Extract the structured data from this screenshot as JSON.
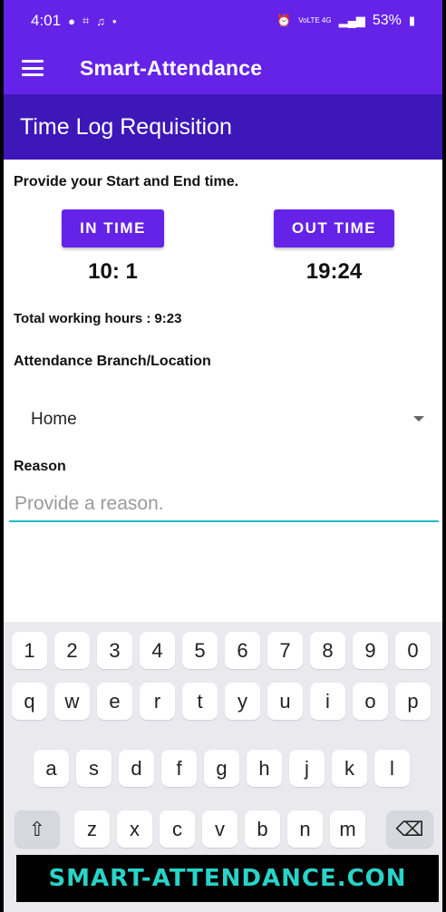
{
  "status_bar": {
    "time": "4:01",
    "network_label": "VoLTE 4G",
    "battery_percent": "53%"
  },
  "app_bar": {
    "title": "Smart-Attendance"
  },
  "page": {
    "title": "Time Log Requisition"
  },
  "form": {
    "prompt": "Provide your Start and End time.",
    "in_time_label": "IN TIME",
    "in_time_value": "10: 1",
    "out_time_label": "OUT TIME",
    "out_time_value": "19:24",
    "total_hours_label": "Total working hours :",
    "total_hours_value": "9:23",
    "branch_label": "Attendance Branch/Location",
    "branch_selected": "Home",
    "reason_label": "Reason",
    "reason_placeholder": "Provide a reason.",
    "reason_value": ""
  },
  "keyboard": {
    "row_numbers": [
      "1",
      "2",
      "3",
      "4",
      "5",
      "6",
      "7",
      "8",
      "9",
      "0"
    ],
    "row_top": [
      "q",
      "w",
      "e",
      "r",
      "t",
      "y",
      "u",
      "i",
      "o",
      "p"
    ],
    "row_middle": [
      "a",
      "s",
      "d",
      "f",
      "g",
      "h",
      "j",
      "k",
      "l"
    ],
    "row_bottom": [
      "z",
      "x",
      "c",
      "v",
      "b",
      "n",
      "m"
    ],
    "shift_symbol": "⇧",
    "backspace_symbol": "⌫"
  },
  "watermark": {
    "text": "SMART-ATTENDANCE.CON"
  },
  "colors": {
    "primary": "#6523e8",
    "primary_dark": "#3d17b8",
    "accent": "#1fbcc6",
    "watermark_text": "#29d3c8"
  }
}
